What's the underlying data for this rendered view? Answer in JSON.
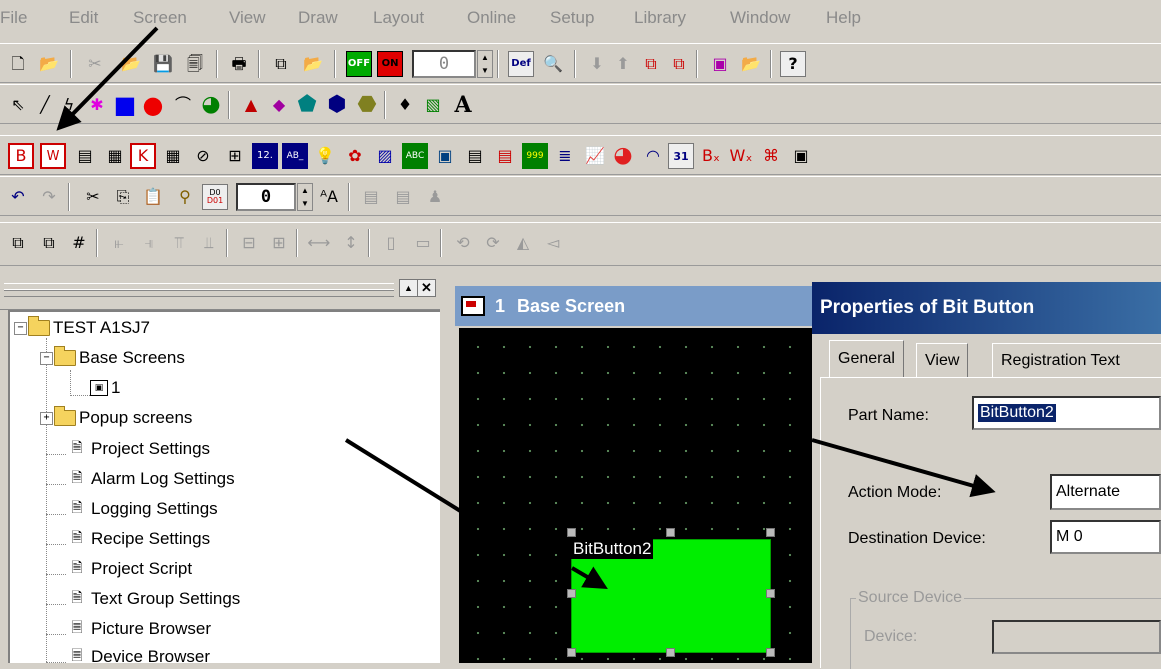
{
  "menu": [
    "File",
    "Edit",
    "Screen",
    "View",
    "Draw",
    "Layout",
    "Online",
    "Setup",
    "Library",
    "Window",
    "Help"
  ],
  "toolbar": {
    "counter_value": "0",
    "off_label": "OFF",
    "on_label": "ON",
    "def_label": "Def",
    "font_size_value": "0",
    "bit_button_icon": "B",
    "word_button_icon": "W",
    "key_icon": "K",
    "numeric_icon": "12.",
    "ascii_icon": "AB_",
    "abc_icon": "ABC",
    "n999_icon": "999",
    "cal_icon": "31",
    "text_tool_icon": "A",
    "do_label": "D0",
    "d01_label": "D01",
    "help_icon": "?"
  },
  "tree": {
    "root": "TEST A1SJ7",
    "items": [
      {
        "label": "Base Screens",
        "icon": "folder-open-icon"
      },
      {
        "label": "1",
        "icon": "screen-icon"
      },
      {
        "label": "Popup screens",
        "icon": "folder-icon"
      },
      {
        "label": "Project Settings",
        "icon": "settings-icon"
      },
      {
        "label": "Alarm Log Settings",
        "icon": "settings-icon"
      },
      {
        "label": "Logging Settings",
        "icon": "settings-icon"
      },
      {
        "label": "Recipe Settings",
        "icon": "settings-icon"
      },
      {
        "label": "Project Script",
        "icon": "settings-icon"
      },
      {
        "label": "Text Group Settings",
        "icon": "settings-icon"
      },
      {
        "label": "Picture Browser",
        "icon": "document-icon"
      },
      {
        "label": "Device Browser",
        "icon": "document-icon"
      }
    ]
  },
  "base_screen": {
    "number": "1",
    "title": "Base Screen",
    "button_label": "BitButton2",
    "button_color": "#00ee00"
  },
  "dialog": {
    "title": "Properties of Bit Button",
    "tabs": [
      "General",
      "View",
      "Registration Text"
    ],
    "part_name_label": "Part Name:",
    "part_name_value": "BitButton2",
    "action_mode_label": "Action Mode:",
    "action_mode_value": "Alternate",
    "dest_device_label": "Destination Device:",
    "dest_device_value": "M 0",
    "source_device_label": "Source Device",
    "device_label": "Device:"
  },
  "colors": {
    "accent_title": "#0a246a",
    "toolbar_bg": "#d4d0c8",
    "canvas_bg": "#000000"
  }
}
